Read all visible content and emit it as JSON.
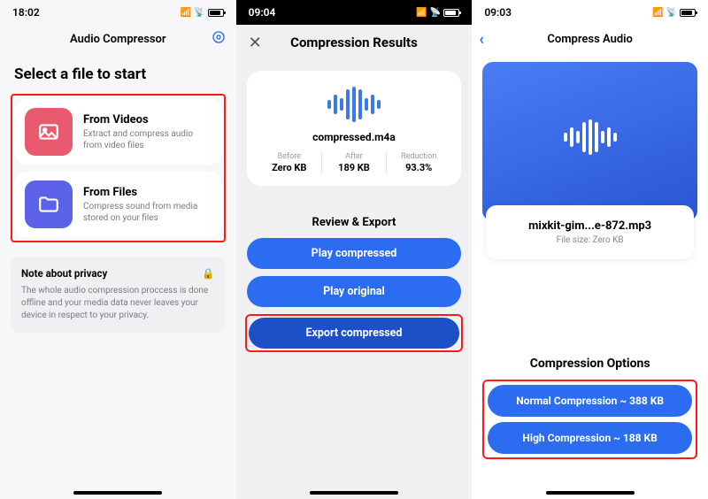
{
  "phone1": {
    "time": "18:02",
    "header": "Audio Compressor",
    "heading": "Select a file to start",
    "options": [
      {
        "title": "From Videos",
        "desc": "Extract and compress audio from video files"
      },
      {
        "title": "From Files",
        "desc": "Compress sound from media stored on your files"
      }
    ],
    "privacy": {
      "title": "Note about privacy",
      "text": "The whole audio compression proccess is done offline and your media data never leaves your device in respect to your privacy."
    }
  },
  "phone2": {
    "time": "09:04",
    "title": "Compression Results",
    "filename": "compressed.m4a",
    "stats": {
      "before_label": "Before",
      "before_value": "Zero KB",
      "after_label": "After",
      "after_value": "189 KB",
      "reduction_label": "Reduction",
      "reduction_value": "93.3%"
    },
    "review_title": "Review & Export",
    "buttons": {
      "play_compressed": "Play compressed",
      "play_original": "Play original",
      "export": "Export compressed"
    }
  },
  "phone3": {
    "time": "09:03",
    "header": "Compress Audio",
    "filename": "mixkit-gim...e-872.mp3",
    "filesize": "File size: Zero KB",
    "options_title": "Compression Options",
    "normal": "Normal Compression ~ 388 KB",
    "high": "High Compression ~ 188 KB"
  }
}
